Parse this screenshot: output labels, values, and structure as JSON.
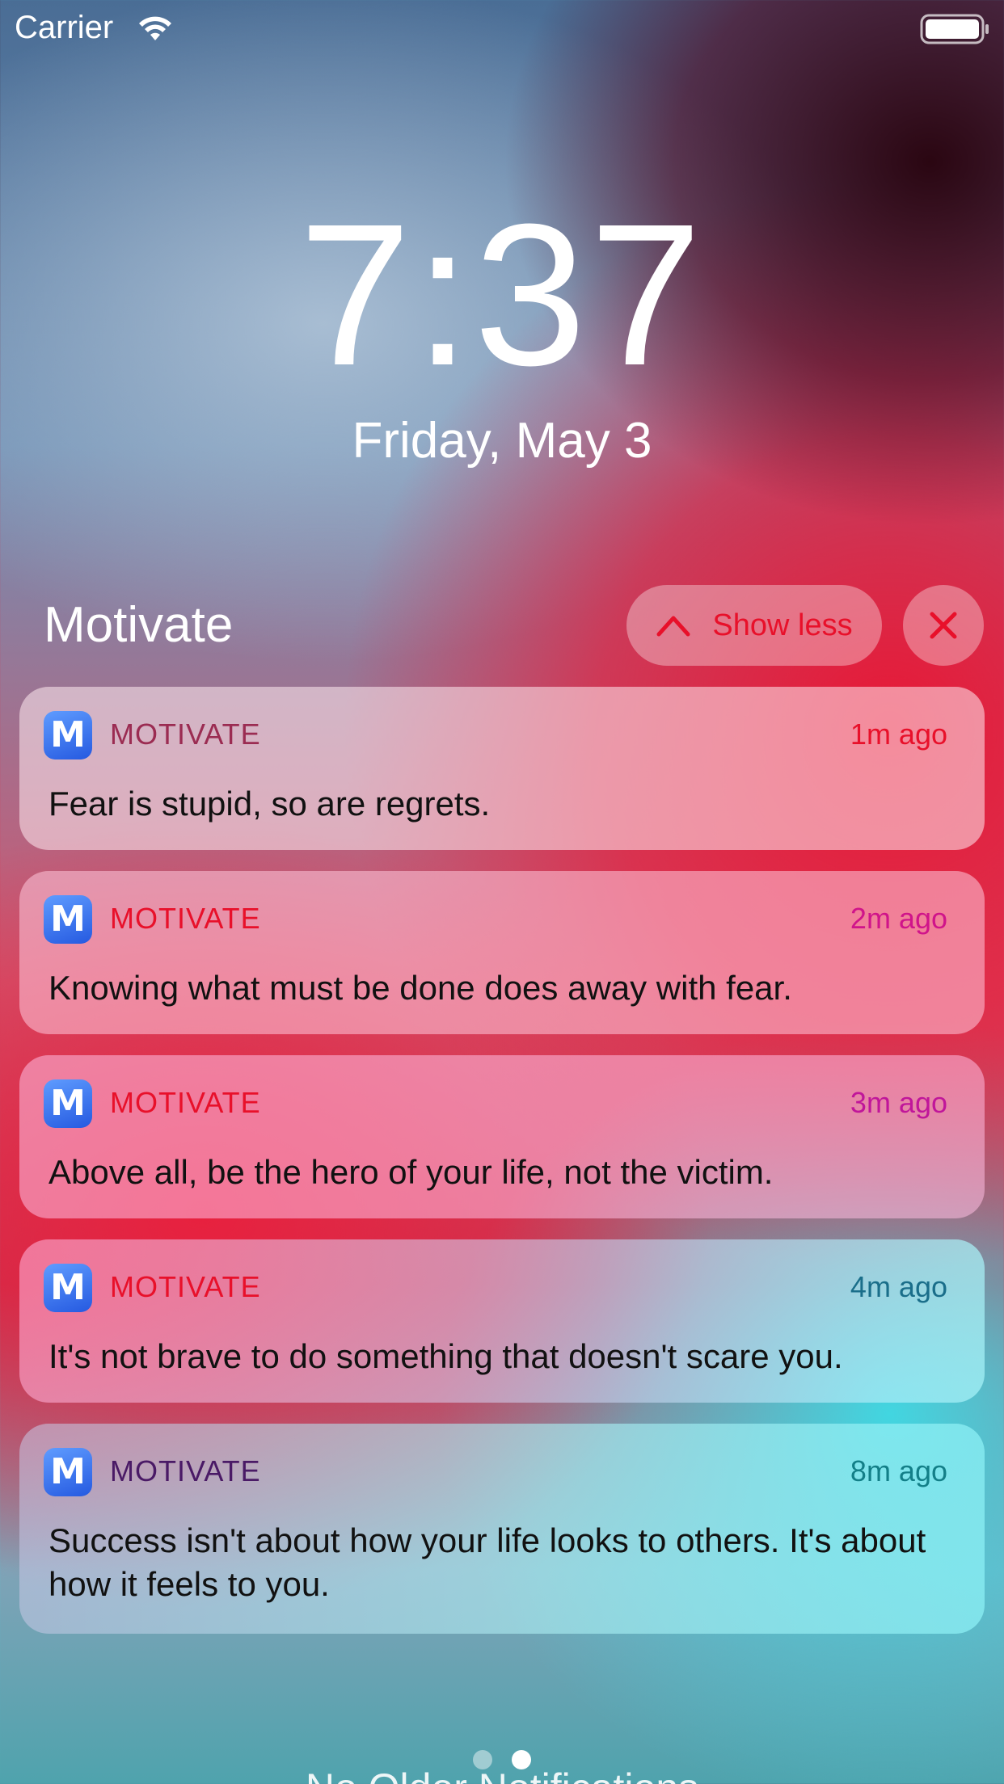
{
  "status_bar": {
    "carrier": "Carrier",
    "wifi_icon": "wifi-icon",
    "battery_icon": "battery-icon"
  },
  "lock_screen": {
    "time": "7:37",
    "date": "Friday, May 3"
  },
  "notification_group": {
    "title": "Motivate",
    "show_less_label": "Show less",
    "accent_color": "#e8102a"
  },
  "notifications": [
    {
      "app": "MOTIVATE",
      "time_ago": "1m ago",
      "message": "Fear is stupid, so are regrets.",
      "app_color": "#9b2c52",
      "time_color": "#e8102a"
    },
    {
      "app": "MOTIVATE",
      "time_ago": "2m ago",
      "message": "Knowing what must be done does away with fear.",
      "app_color": "#e8102a",
      "time_color": "#d0148a"
    },
    {
      "app": "MOTIVATE",
      "time_ago": "3m ago",
      "message": "Above all, be the hero of your life, not the victim.",
      "app_color": "#e8102a",
      "time_color": "#c0169a"
    },
    {
      "app": "MOTIVATE",
      "time_ago": "4m ago",
      "message": "It's not brave to do something that doesn't scare you.",
      "app_color": "#e8102a",
      "time_color": "#1a6e8a"
    },
    {
      "app": "MOTIVATE",
      "time_ago": "8m ago",
      "message": "Success isn't about how your life looks to others. It's about how it feels to you.",
      "app_color": "#4a1a66",
      "time_color": "#137f88"
    }
  ],
  "footer": {
    "no_older": "No Older Notifications",
    "page_count": 2,
    "active_page": 2
  }
}
